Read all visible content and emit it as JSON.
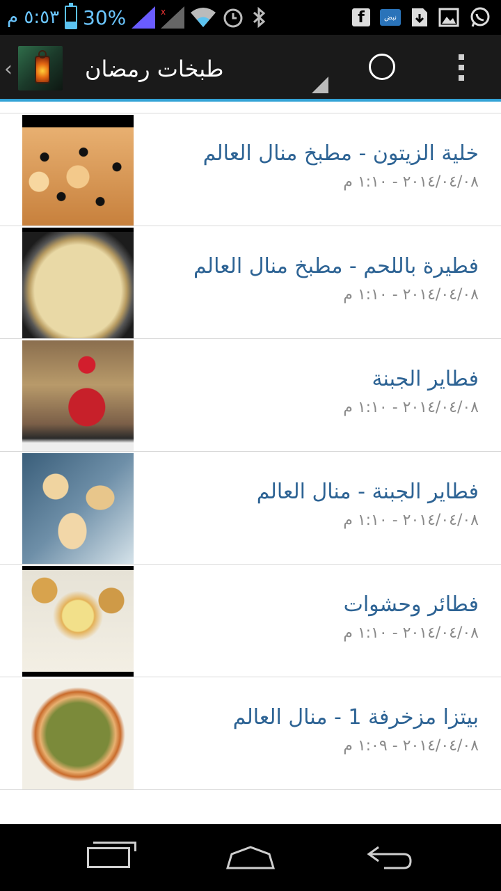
{
  "status_bar": {
    "time": "٥:٥٣ م",
    "battery_percent": "30%",
    "battery_level": 0.3
  },
  "action_bar": {
    "title": "طبخات رمضان"
  },
  "recipes": [
    {
      "title": "خلية الزيتون - مطبخ منال العالم",
      "date": "٢٠١٤/٠٤/٠٨ - ١:١٠ م"
    },
    {
      "title": "فطيرة باللحم - مطبخ منال العالم",
      "date": "٢٠١٤/٠٤/٠٨ - ١:١٠ م"
    },
    {
      "title": "فطاير الجبنة",
      "date": "٢٠١٤/٠٤/٠٨ - ١:١٠ م"
    },
    {
      "title": "فطاير الجبنة - منال العالم",
      "date": "٢٠١٤/٠٤/٠٨ - ١:١٠ م"
    },
    {
      "title": "فطائر وحشوات",
      "date": "٢٠١٤/٠٤/٠٨ - ١:١٠ م"
    },
    {
      "title": "بيتزا مزخرفة 1 - منال العالم",
      "date": "٢٠١٤/٠٤/٠٨ - ١:٠٩ م"
    }
  ],
  "colors": {
    "accent": "#33a3d6",
    "title_text": "#2d6394",
    "date_text": "#8a8a8a"
  }
}
